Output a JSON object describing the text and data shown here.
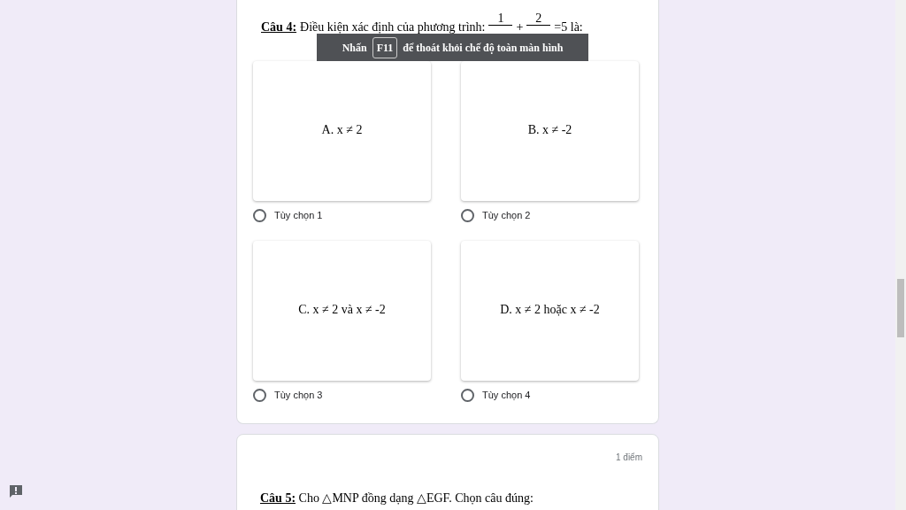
{
  "question_4": {
    "label": "Câu 4:",
    "text": "Điều kiện xác định của phương trình:",
    "numerators": [
      "1",
      "2"
    ],
    "operator": "+",
    "tail": "=5  là:"
  },
  "fullscreen_notice": {
    "before": "Nhấn",
    "key": "F11",
    "after": "để thoát khỏi chế độ toàn màn hình"
  },
  "options": [
    {
      "content": "A. x ≠ 2",
      "label": "Tùy chọn 1",
      "selected": false
    },
    {
      "content": "B.  x ≠ -2",
      "label": "Tùy chọn 2",
      "selected": false
    },
    {
      "content": "C.  x ≠ 2 và  x ≠ -2",
      "label": "Tùy chọn 3",
      "selected": false
    },
    {
      "content": "D.  x ≠ 2 hoặc x ≠ -2",
      "label": "Tùy chọn 4",
      "selected": false
    }
  ],
  "question_5": {
    "points": "1 điểm",
    "label": "Câu 5:",
    "text": "Cho △MNP  đồng dạng △EGF. Chọn câu đúng:"
  }
}
